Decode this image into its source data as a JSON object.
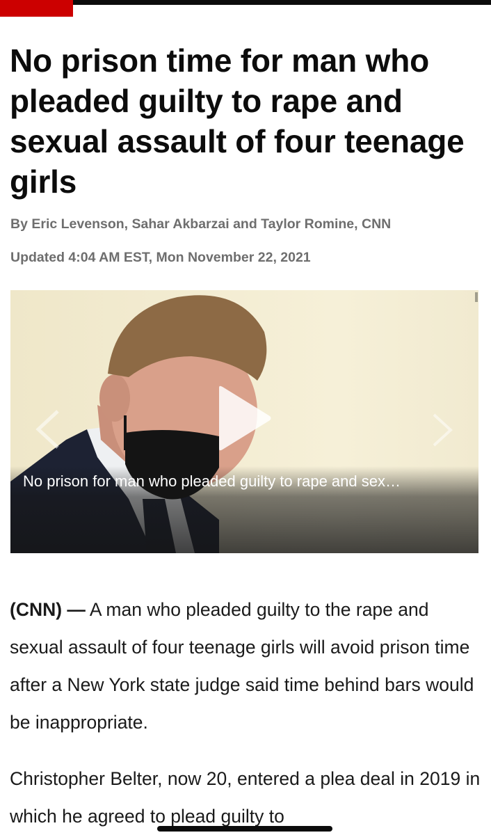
{
  "header": {
    "brand_color": "#cc0000"
  },
  "article": {
    "headline": "No prison time for man who pleaded guilty to rape and sexual assault of four teenage girls",
    "byline": "By Eric Levenson, Sahar Akbarzai and Taylor Romine, CNN",
    "updated": "Updated 4:04 AM EST, Mon November 22, 2021"
  },
  "video": {
    "caption": "No prison for man who pleaded guilty to rape and sex…",
    "play_icon": "play-icon",
    "prev_icon": "chevron-left-icon",
    "next_icon": "chevron-right-icon"
  },
  "body": {
    "p1_lead": "(CNN) —",
    "p1_text": " A man who pleaded guilty to the rape and sexual assault of four teenage girls will avoid prison time after a New York state judge said time behind bars would be inappropriate.",
    "p2_text": "Christopher Belter, now 20, entered a plea deal in 2019 in which he agreed to plead guilty to"
  }
}
